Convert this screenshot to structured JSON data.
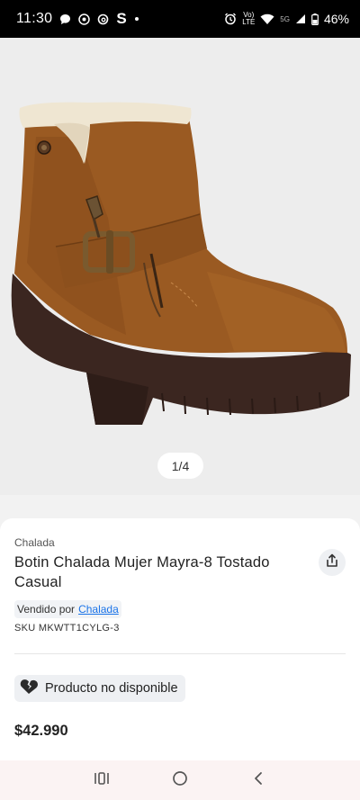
{
  "status_bar": {
    "time": "11:30",
    "carrier_top": "Vo)",
    "carrier_bottom": "LTE",
    "net_label": "5G",
    "battery": "46%"
  },
  "gallery": {
    "pager": "1/4"
  },
  "product": {
    "brand": "Chalada",
    "title": "Botin Chalada Mujer Mayra-8 Tostado Casual",
    "sold_by_label": "Vendido por",
    "seller": "Chalada",
    "sku": "SKU MKWTT1CYLG-3",
    "availability": "Producto no disponible",
    "price": "$42.990"
  },
  "colors": {
    "boot_suede": "#9a5a22",
    "sole": "#3b2620",
    "fleece": "#efe6d2",
    "link": "#1a73e8"
  },
  "icons": {
    "share": "share-icon",
    "broken_heart": "broken-heart-icon",
    "recents": "recents-icon",
    "home": "home-icon",
    "back": "back-icon"
  }
}
